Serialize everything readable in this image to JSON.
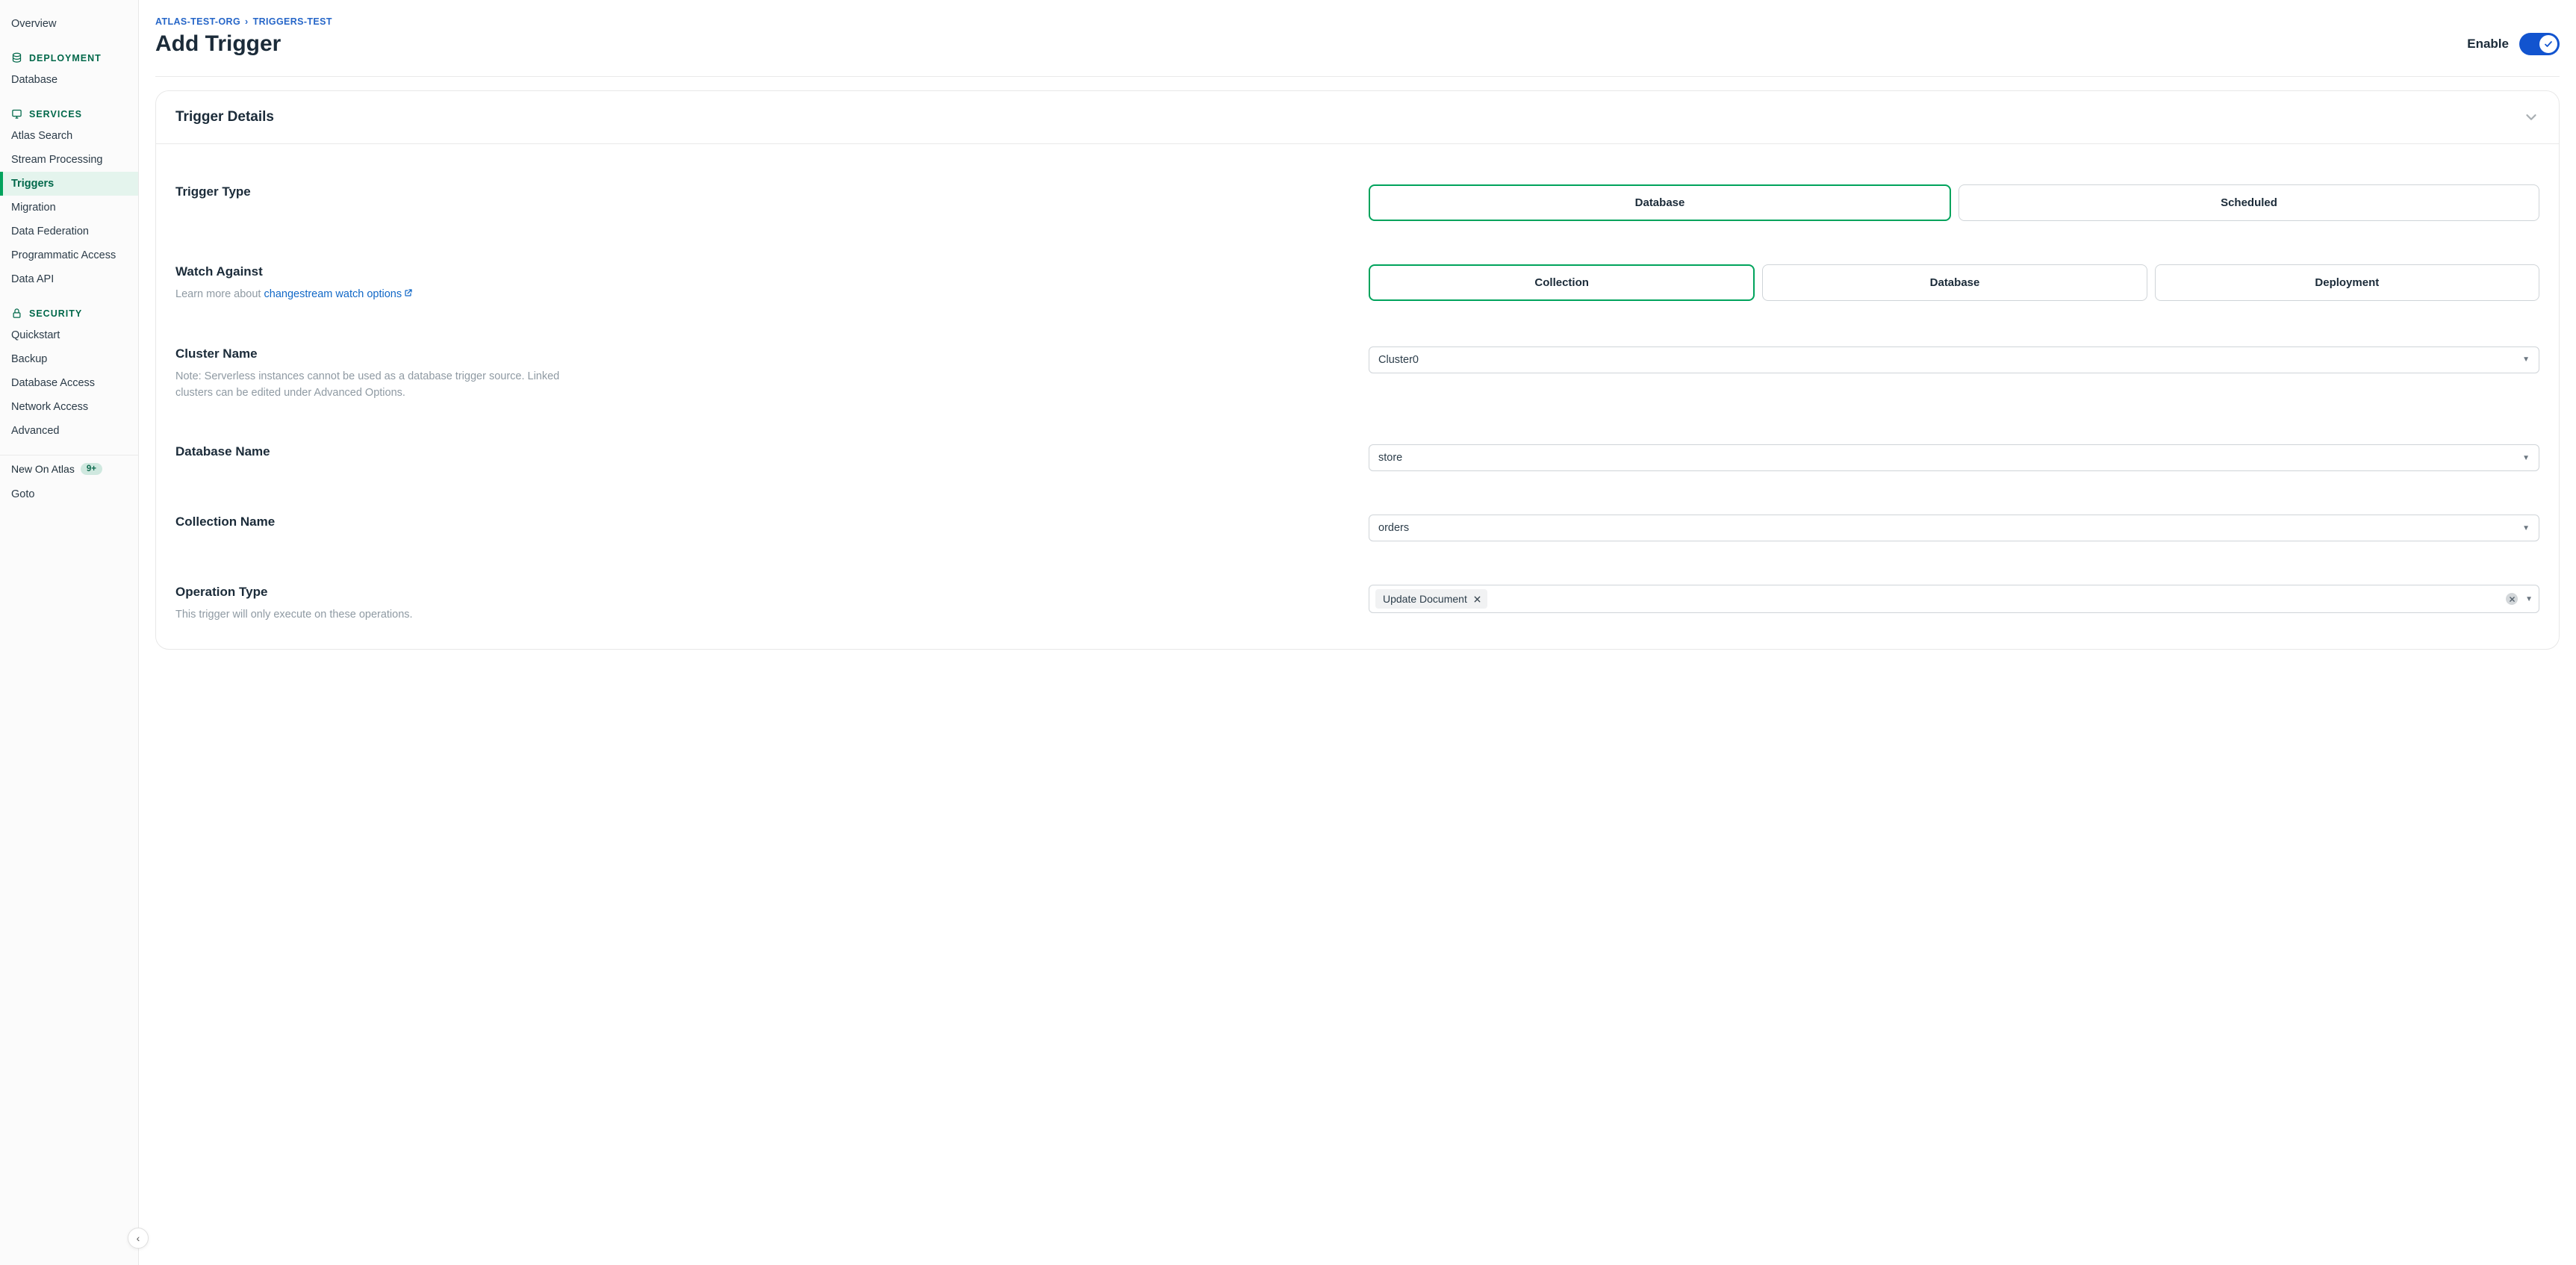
{
  "sidebar": {
    "overview": "Overview",
    "sections": {
      "deployment": {
        "title": "DEPLOYMENT",
        "items": [
          "Database"
        ]
      },
      "services": {
        "title": "SERVICES",
        "items": [
          "Atlas Search",
          "Stream Processing",
          "Triggers",
          "Migration",
          "Data Federation",
          "Programmatic Access",
          "Data API"
        ],
        "active_index": 2
      },
      "security": {
        "title": "SECURITY",
        "items": [
          "Quickstart",
          "Backup",
          "Database Access",
          "Network Access",
          "Advanced"
        ]
      }
    },
    "extras": {
      "new_on_atlas": {
        "label": "New On Atlas",
        "badge": "9+"
      },
      "goto": "Goto"
    }
  },
  "breadcrumb": {
    "org": "ATLAS-TEST-ORG",
    "project": "TRIGGERS-TEST"
  },
  "header": {
    "title": "Add Trigger",
    "enable_label": "Enable",
    "enabled": true
  },
  "card": {
    "title": "Trigger Details"
  },
  "fields": {
    "trigger_type": {
      "label": "Trigger Type",
      "options": [
        "Database",
        "Scheduled"
      ],
      "selected_index": 0
    },
    "watch_against": {
      "label": "Watch Against",
      "helper_prefix": "Learn more about ",
      "helper_link": "changestream watch options",
      "options": [
        "Collection",
        "Database",
        "Deployment"
      ],
      "selected_index": 0
    },
    "cluster_name": {
      "label": "Cluster Name",
      "note": "Note: Serverless instances cannot be used as a database trigger source. Linked clusters can be edited under Advanced Options.",
      "value": "Cluster0"
    },
    "database_name": {
      "label": "Database Name",
      "value": "store"
    },
    "collection_name": {
      "label": "Collection Name",
      "value": "orders"
    },
    "operation_type": {
      "label": "Operation Type",
      "helper": "This trigger will only execute on these operations.",
      "tokens": [
        "Update Document"
      ]
    }
  }
}
